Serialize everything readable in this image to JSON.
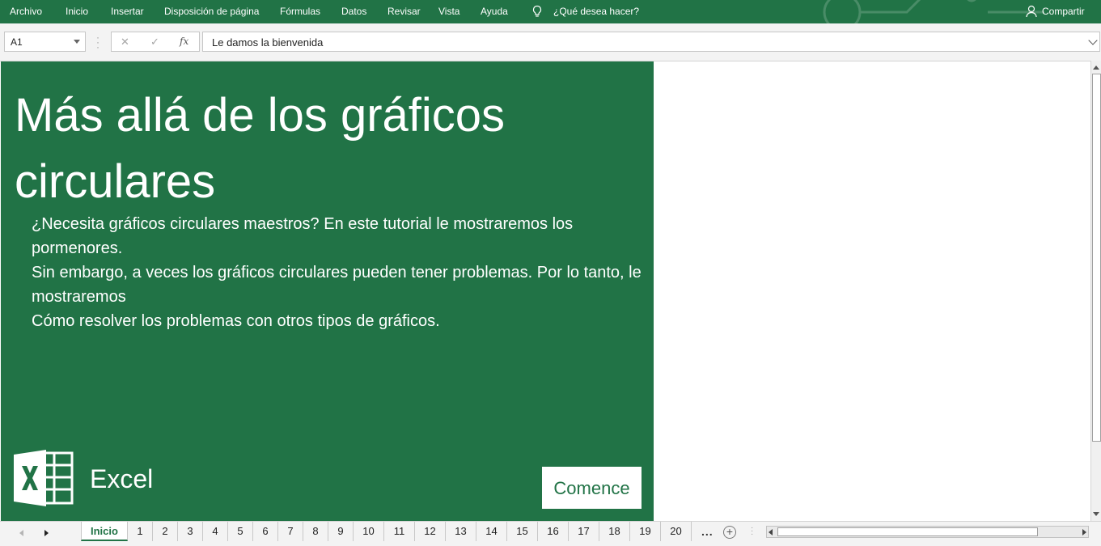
{
  "ribbon": {
    "tabs": [
      "Archivo",
      "Inicio",
      "Insertar",
      "Disposición de página",
      "Fórmulas",
      "Datos",
      "Revisar",
      "Vista",
      "Ayuda"
    ],
    "tell_me": "¿Qué desea hacer?",
    "share": "Compartir",
    "accent_color": "#217346"
  },
  "formula_bar": {
    "name_box": "A1",
    "cancel_icon": "✕",
    "enter_icon": "✓",
    "fx_label": "fx",
    "content": "Le damos la bienvenida"
  },
  "panel": {
    "title": "Más allá de los gráficos circulares",
    "lines": [
      "¿Necesita gráficos circulares maestros? En este tutorial le mostraremos los pormenores.",
      "Sin embargo, a veces los gráficos circulares pueden tener problemas. Por lo tanto, le mostraremos",
      "Cómo resolver los problemas con otros tipos de gráficos."
    ],
    "logo_text": "Excel",
    "start_button": "Comence"
  },
  "sheet_tabs": {
    "active": "Inicio",
    "numbered": [
      "1",
      "2",
      "3",
      "4",
      "5",
      "6",
      "7",
      "8",
      "9",
      "10",
      "11",
      "12",
      "13",
      "14",
      "15",
      "16",
      "17",
      "18",
      "19",
      "20"
    ],
    "more": "...",
    "add": "+"
  }
}
